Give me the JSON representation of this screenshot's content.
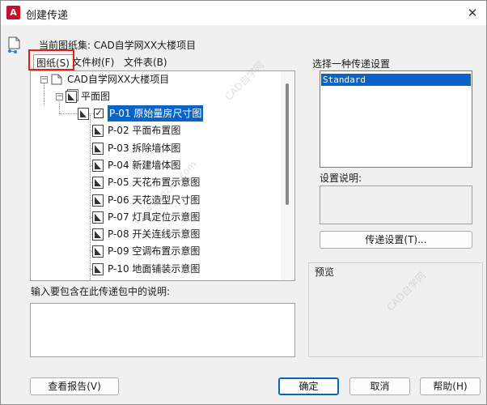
{
  "window": {
    "title": "创建传递",
    "app_icon": "autocad-logo-icon",
    "app_icon_letter": "A",
    "close_glyph": "✕"
  },
  "header": {
    "current_sheet_set": "当前图纸集: CAD自学网XX大楼项目"
  },
  "tabs": [
    {
      "label": "图纸(S)",
      "active": true
    },
    {
      "label": "文件树(F)",
      "active": false
    },
    {
      "label": "文件表(B)",
      "active": false
    }
  ],
  "tree": {
    "root_label": "CAD自学网XX大楼项目",
    "group_label": "平面图",
    "sheets": [
      {
        "label": "P-01 原始量房尺寸图",
        "checked": true,
        "selected": true
      },
      {
        "label": "P-02 平面布置图",
        "checked": false,
        "selected": false
      },
      {
        "label": "P-03 拆除墙体图",
        "checked": false,
        "selected": false
      },
      {
        "label": "P-04 新建墙体图",
        "checked": false,
        "selected": false
      },
      {
        "label": "P-05 天花布置示意图",
        "checked": false,
        "selected": false
      },
      {
        "label": "P-06 天花造型尺寸图",
        "checked": false,
        "selected": false
      },
      {
        "label": "P-07 灯具定位示意图",
        "checked": false,
        "selected": false
      },
      {
        "label": "P-08 开关连线示意图",
        "checked": false,
        "selected": false
      },
      {
        "label": "P-09 空调布置示意图",
        "checked": false,
        "selected": false
      },
      {
        "label": "P-10 地面铺装示意图",
        "checked": false,
        "selected": false
      }
    ]
  },
  "description": {
    "label": "输入要包含在此传递包中的说明:",
    "value": ""
  },
  "transmittal": {
    "select_label": "选择一种传递设置",
    "options": [
      "Standard"
    ],
    "selected": "Standard",
    "setting_desc_label": "设置说明:",
    "setting_desc_value": "",
    "setup_button": "传递设置(T)..."
  },
  "preview": {
    "label": "预览"
  },
  "footer": {
    "view_report": "查看报告(V)",
    "ok": "确定",
    "cancel": "取消",
    "help": "帮助(H)"
  },
  "colors": {
    "selection": "#0a64c8",
    "highlight_box": "#e02020",
    "app_icon": "#c8102e"
  }
}
